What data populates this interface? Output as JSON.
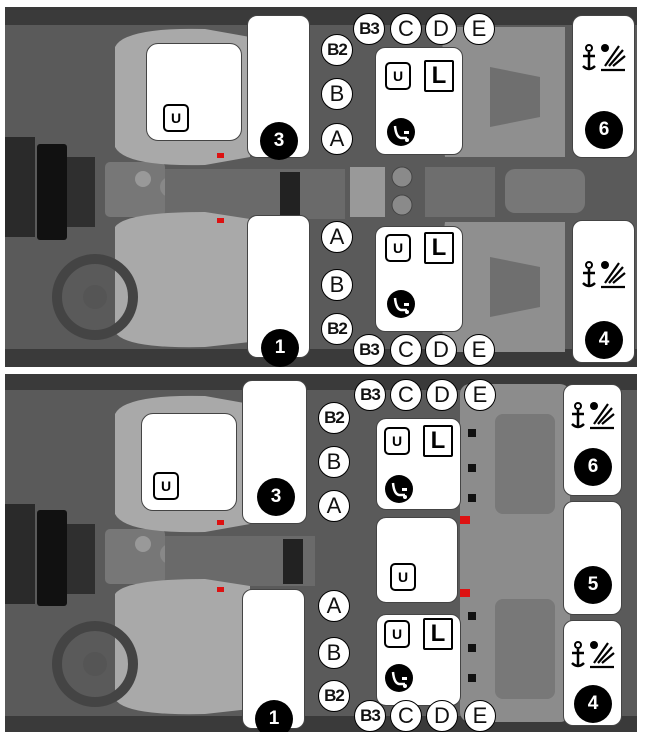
{
  "seat_numbers": {
    "front_right": "3",
    "front_left": "1",
    "rear_right_outer": "6",
    "rear_center": "5",
    "rear_left_outer": "4"
  },
  "positions": {
    "a": "A",
    "b": "B",
    "b2": "B2",
    "b3": "B3",
    "c": "C",
    "d": "D",
    "e": "E"
  },
  "symbols": {
    "universal": "U",
    "isize": "L"
  },
  "icons": [
    "universal-icon",
    "i-size-icon",
    "isofix-child-seat-icon",
    "top-tether-anchor-icon"
  ],
  "colors": {
    "interior": "#5d5d5d",
    "card_fill": "#ffffff",
    "number_badge": "#000000"
  }
}
